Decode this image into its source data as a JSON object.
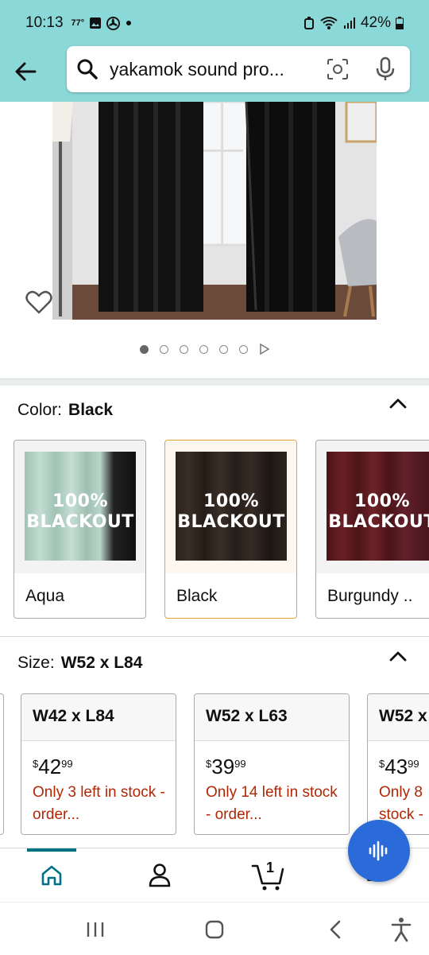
{
  "status": {
    "time": "10:13",
    "temp": "77°",
    "battery": "42%",
    "icons": [
      "gallery-icon",
      "fan-icon",
      "dot-icon",
      "alarm-icon",
      "wifi-icon",
      "signal-icon",
      "battery-icon"
    ]
  },
  "search": {
    "query": "yakamok sound pro..."
  },
  "carousel": {
    "dots": 6,
    "active_index": 0
  },
  "color": {
    "label": "Color:",
    "selected": "Black",
    "options": [
      {
        "label": "Aqua",
        "swatch_text": "100%\nBLACKOUT",
        "line1": "100%",
        "line2": "BLACKOUT",
        "color": "#a9cbbf"
      },
      {
        "label": "Black",
        "line1": "100%",
        "line2": "BLACKOUT",
        "color": "#2a221c"
      },
      {
        "label": "Burgundy ..",
        "line1": "100%",
        "line2": "BLACKOUT",
        "color": "#5a1a20"
      }
    ]
  },
  "size": {
    "label": "Size:",
    "selected": "W52 x L84",
    "options": [
      {
        "label": "W42 x L84",
        "price_whole": "42",
        "price_cents": "99",
        "currency": "$",
        "stock": "Only 3 left in stock - order..."
      },
      {
        "label": "W52 x L63",
        "price_whole": "39",
        "price_cents": "99",
        "currency": "$",
        "stock": "Only 14 left in stock - order..."
      },
      {
        "label": "W52 x",
        "price_whole": "43",
        "price_cents": "99",
        "currency": "$",
        "stock": "Only 8 stock -"
      }
    ]
  },
  "bottom_nav": {
    "cart_count": "1",
    "items": [
      "home-icon",
      "account-icon",
      "cart-icon",
      "menu-icon"
    ]
  },
  "colors": {
    "header_bg": "#8bd8d9",
    "price_red": "#b12704",
    "selected_border": "#e0a43a",
    "fab_blue": "#2a6ad9",
    "nav_teal": "#007185"
  }
}
